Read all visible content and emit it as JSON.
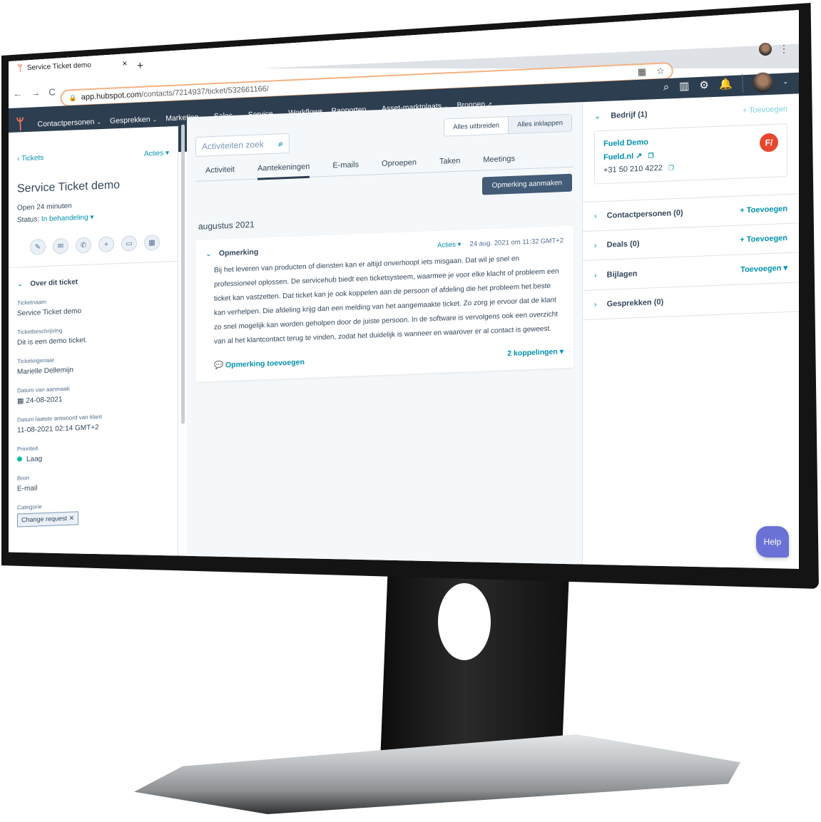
{
  "browser": {
    "tab_title": "Service Ticket demo",
    "url_host": "app.hubspot.com",
    "url_path": "/contacts/7214937/ticket/532661166/",
    "new_tab_label": "+",
    "close_tab_label": "×",
    "back_label": "←",
    "forward_label": "→",
    "reload_label": "C"
  },
  "topnav": {
    "items": [
      {
        "label": "Contactpersonen",
        "has_menu": true
      },
      {
        "label": "Gesprekken",
        "has_menu": true
      },
      {
        "label": "Marketing",
        "has_menu": true
      },
      {
        "label": "Sales",
        "has_menu": true
      },
      {
        "label": "Service",
        "has_menu": true
      },
      {
        "label": "Workflows",
        "has_menu": false
      },
      {
        "label": "Rapporten",
        "has_menu": true
      },
      {
        "label": "Asset-marktplaats",
        "has_menu": true
      },
      {
        "label": "Bronnen",
        "has_menu": false,
        "external": true
      }
    ]
  },
  "left": {
    "back_link": "Tickets",
    "actions_label": "Acties",
    "ticket_title": "Service Ticket demo",
    "open_duration": "Open 24 minuten",
    "status_label": "Status:",
    "status_value": "In behandeling",
    "action_icons": [
      "note-icon",
      "email-icon",
      "call-icon",
      "add-icon",
      "task-icon",
      "meeting-icon"
    ],
    "section_title": "Over dit ticket",
    "fields": [
      {
        "label": "Ticketnaam",
        "value": "Service Ticket demo"
      },
      {
        "label": "Ticketbeschrijving",
        "value": "Dit is een demo ticket."
      },
      {
        "label": "Ticketeigenaar",
        "value": "Marielle Dellemijn"
      },
      {
        "label": "Datum van aanmaak",
        "value": "24-08-2021"
      },
      {
        "label": "Datum laatste antwoord van klant",
        "value": "11-08-2021 02:14 GMT+2"
      },
      {
        "label": "Prioriteit",
        "value": "Laag"
      },
      {
        "label": "Bron",
        "value": "E-mail"
      },
      {
        "label": "Categorie",
        "value": "Change request"
      }
    ],
    "priority_color": "#00bda5"
  },
  "center": {
    "search_placeholder": "Activiteiten zoek",
    "expand_all": "Alles uitbreiden",
    "collapse_all": "Alles inklappen",
    "tabs": [
      "Activiteit",
      "Aantekeningen",
      "E-mails",
      "Oproepen",
      "Taken",
      "Meetings"
    ],
    "active_tab": "Aantekeningen",
    "create_note_button": "Opmerking aanmaken",
    "month": "augustus 2021",
    "note": {
      "title": "Opmerking",
      "actions_label": "Acties",
      "timestamp": "24 aug. 2021 om 11:32 GMT+2",
      "body": "Bij het leveren van producten of diensten kan er altijd onverhoopt iets misgaan. Dat wil je snel en professioneel oplossen. De servicehub biedt een ticketsysteem, waarmee je voor elke klacht of probleem een ticket kan vastzetten. Dat ticket kan je ook koppelen aan de persoon of afdeling die het probleem het beste kan verhelpen. Die afdeling krijg dan een melding van het aangemaakte ticket. Zo zorg je ervoor dat de klant zo snel mogelijk kan worden geholpen door de juiste persoon. In de software is vervolgens ook een overzicht van al het klantcontact terug te vinden, zodat het duidelijk is wanneer en waarover er al contact is geweest.",
      "add_comment": "Opmerking toevoegen",
      "associations": "2 koppelingen"
    }
  },
  "right": {
    "company_section": {
      "title": "Bedrijf (1)",
      "add_label": "+ Toevoegen"
    },
    "company": {
      "name": "Fueld Demo",
      "website": "Fueld.nl",
      "phone": "+31 50 210 4222",
      "logo_text": "F/",
      "logo_color": "#e8472f"
    },
    "sections": [
      {
        "title": "Contactpersonen (0)",
        "add_label": "+ Toevoegen"
      },
      {
        "title": "Deals (0)",
        "add_label": "+ Toevoegen"
      },
      {
        "title": "Bijlagen",
        "add_label": "Toevoegen ▾"
      },
      {
        "title": "Gesprekken (0)",
        "add_label": ""
      }
    ]
  },
  "help_label": "Help",
  "colors": {
    "nav_bg": "#2d3e50",
    "accent": "#0091ae",
    "hubspot_orange": "#ff7a59",
    "help": "#6b72d6"
  }
}
